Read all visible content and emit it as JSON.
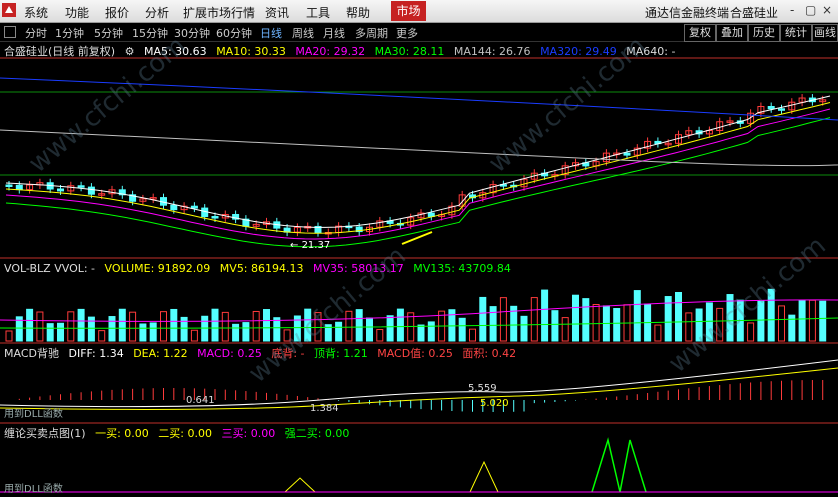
{
  "menu": [
    "系统",
    "功能",
    "报价",
    "分析",
    "扩展市场行情",
    "资讯",
    "工具",
    "帮助"
  ],
  "menu_active": "市场",
  "app_title": "通达信金融终端",
  "stock_name": "合盛硅业",
  "window_controls": [
    "-",
    "▢",
    "×"
  ],
  "toolbar": {
    "periods": [
      "分时",
      "1分钟",
      "5分钟",
      "15分钟",
      "30分钟",
      "60分钟",
      "日线",
      "周线",
      "月线",
      "多周期",
      "更多"
    ],
    "active_period": "日线",
    "right_buttons": [
      "复权",
      "叠加",
      "历史",
      "统计",
      "画线"
    ]
  },
  "kline_info": {
    "label": "合盛硅业(日线 前复权)",
    "ma5": "MA5: 30.63",
    "ma10": "MA10: 30.33",
    "ma20": "MA20: 29.32",
    "ma30": "MA30: 28.11",
    "ma144": "MA144: 26.76",
    "ma320": "MA320: 29.49",
    "ma640": "MA640: -"
  },
  "low_label": "21.37",
  "vol_info": {
    "label": "VOL-BLZ VVOL: -",
    "volume": "VOLUME: 91892.09",
    "mv5": "MV5: 86194.13",
    "mv35": "MV35: 58013.17",
    "mv135": "MV135: 43709.84"
  },
  "macd_info": {
    "label": "MACD背驰",
    "diff": "DIFF: 1.34",
    "dea": "DEA: 1.22",
    "macd": "MACD: 0.25",
    "dibei": "底背: -",
    "dingbei": "顶背: 1.21",
    "macd_zhi": "MACD值: 0.25",
    "mianji": "面积: 0.42"
  },
  "macd_labels": [
    "0.641",
    "1.384",
    "5.559",
    "5.020"
  ],
  "chan_info": {
    "label": "缠论买卖点图(1)",
    "buy1": "一买: 0.00",
    "buy2": "二买: 0.00",
    "buy3": "三买: 0.00",
    "strong2": "强二买: 0.00"
  },
  "dll_label": "用到DLL函数",
  "watermark": "www.cfchi.com",
  "colors": {
    "up": "#ff3b3b",
    "down": "#54ffff",
    "ma5": "#ffffff",
    "ma10": "#ffff00",
    "ma20": "#ff00ff",
    "ma30": "#00ff00",
    "ma144": "#c0c0c0",
    "ma320": "#1a3cff"
  }
}
